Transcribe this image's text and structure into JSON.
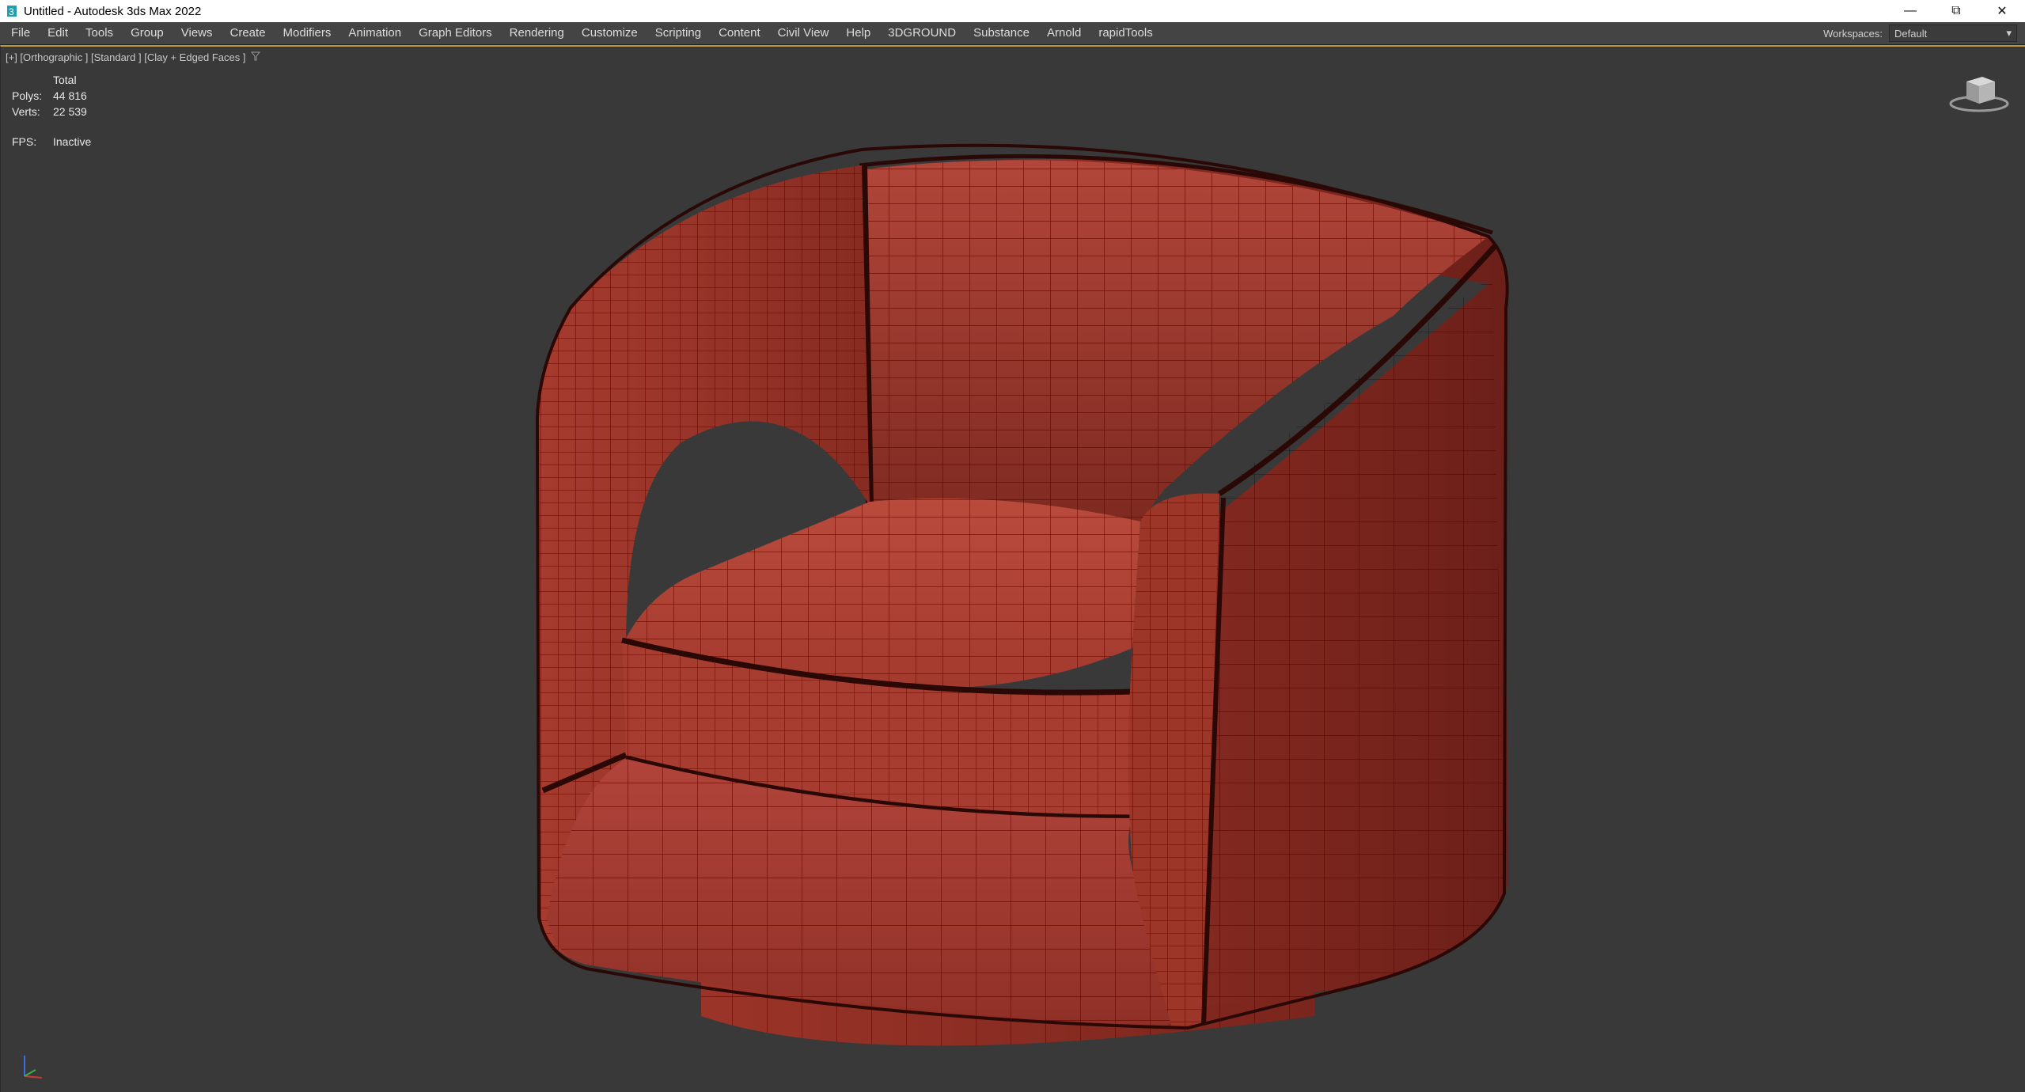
{
  "window": {
    "title": "Untitled - Autodesk 3ds Max 2022",
    "icons": [
      "app-icon",
      "minimize-icon",
      "restore-icon",
      "close-icon"
    ]
  },
  "menu": {
    "items": [
      "File",
      "Edit",
      "Tools",
      "Group",
      "Views",
      "Create",
      "Modifiers",
      "Animation",
      "Graph Editors",
      "Rendering",
      "Customize",
      "Scripting",
      "Content",
      "Civil View",
      "Help",
      "3DGROUND",
      "Substance",
      "Arnold",
      "rapidTools"
    ],
    "workspaces_label": "Workspaces:",
    "workspace_value": "Default"
  },
  "viewport": {
    "label": "[+] [Orthographic ] [Standard ] [Clay + Edged Faces ]",
    "stats": {
      "header": "Total",
      "polys_label": "Polys:",
      "polys_value": "44 816",
      "verts_label": "Verts:",
      "verts_value": "22 539",
      "fps_label": "FPS:",
      "fps_value": "Inactive"
    },
    "colors": {
      "background": "#393939",
      "clay": "#a9392d",
      "wire": "#3a0f0c",
      "active_border": "#b99a3a"
    }
  }
}
